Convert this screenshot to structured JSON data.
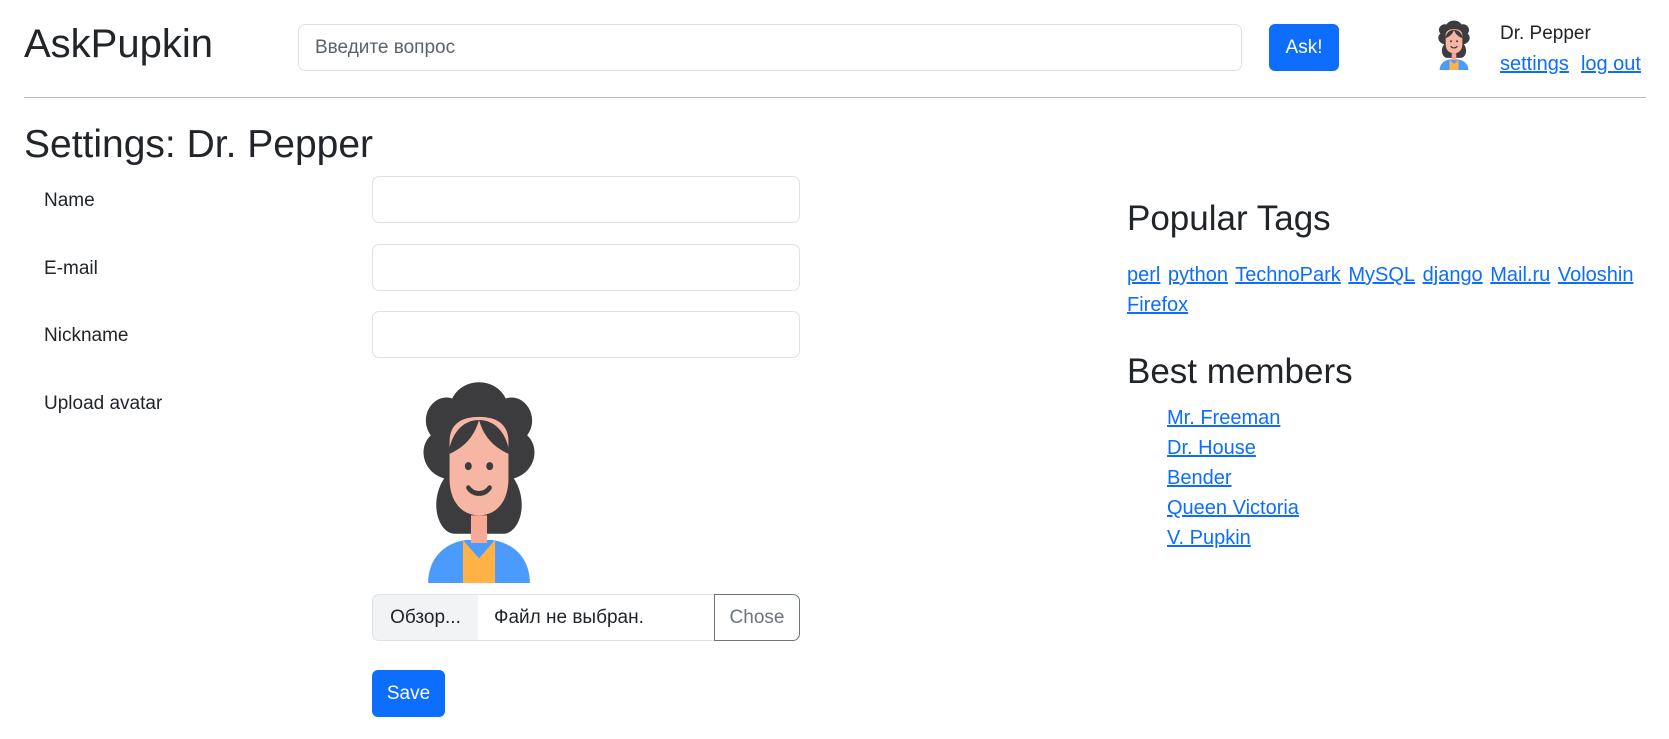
{
  "header": {
    "brand": "AskPupkin",
    "search_placeholder": "Введите вопрос",
    "ask_label": "Ask!",
    "user_name": "Dr. Pepper",
    "settings_link": "settings",
    "logout_link": "log out"
  },
  "page_title": "Settings: Dr. Pepper",
  "form": {
    "name_label": "Name",
    "email_label": "E-mail",
    "nickname_label": "Nickname",
    "avatar_label": "Upload avatar",
    "browse_label": "Обзор...",
    "file_status": "Файл не выбран.",
    "chose_label": "Chose",
    "save_label": "Save"
  },
  "sidebar": {
    "tags_title": "Popular Tags",
    "tags": [
      "perl",
      "python",
      "TechnoPark",
      "MySQL",
      "django",
      "Mail.ru",
      "Voloshin",
      "Firefox"
    ],
    "members_title": "Best members",
    "members": [
      "Mr. Freeman",
      "Dr. House",
      "Bender",
      "Queen Victoria",
      "V. Pupkin"
    ]
  },
  "icons": {
    "avatar": "woman-avatar-icon"
  },
  "colors": {
    "primary": "#0d6efd",
    "text": "#212529"
  }
}
